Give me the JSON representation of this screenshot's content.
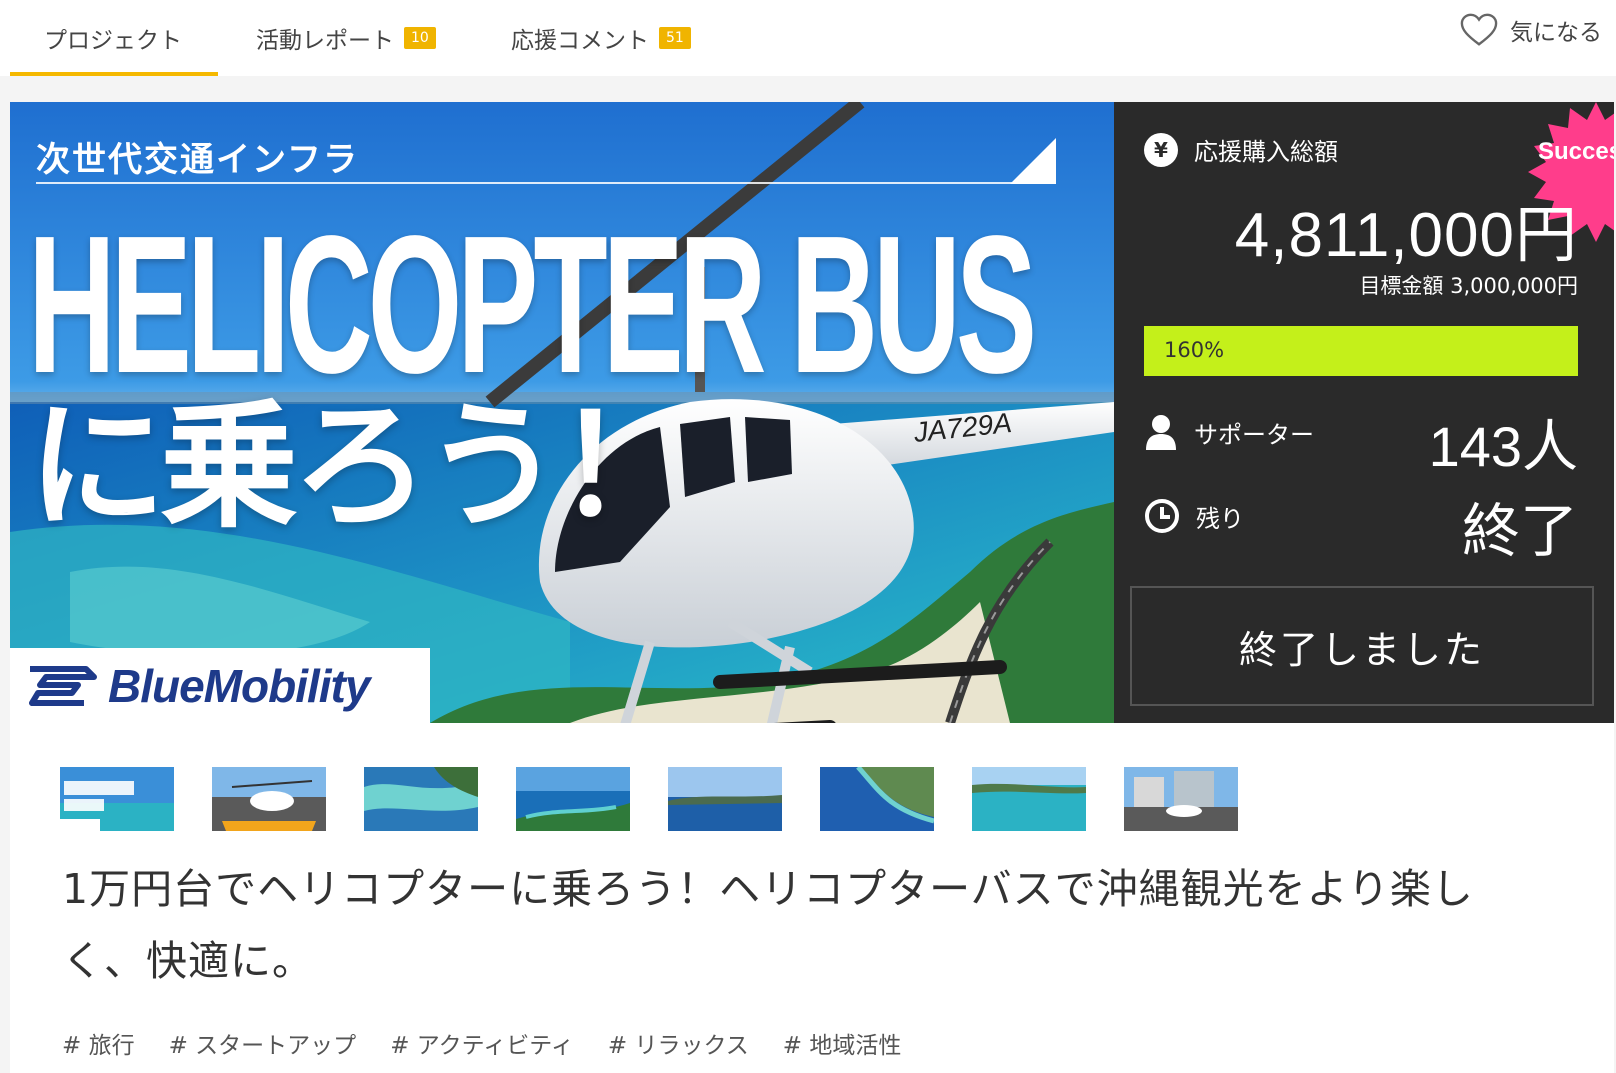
{
  "tabs": [
    {
      "label": "プロジェクト",
      "badge": ""
    },
    {
      "label": "活動レポート",
      "badge": "10"
    },
    {
      "label": "応援コメント",
      "badge": "51"
    }
  ],
  "favorite": {
    "label": "気になる",
    "icon": "heart-icon"
  },
  "hero": {
    "banner_subtitle": "次世代交通インフラ",
    "banner_title_line1": "HELICOPTER BUS",
    "banner_title_line2": "に乗ろう！",
    "brand": "BlueMobility",
    "registration": "JA729A"
  },
  "panel": {
    "total_label": "応援購入総額",
    "total_amount": "4,811,000円",
    "goal": "目標金額 3,000,000円",
    "progress_percent": 160,
    "progress_text": "160%",
    "supporters_label": "サポーター",
    "supporters_value": "143人",
    "remaining_label": "残り",
    "remaining_value": "終了",
    "ended_button": "終了しました",
    "success_badge": "Success!",
    "colors": {
      "panel_bg": "#2a2a2a",
      "progress": "#c4f01a",
      "badge": "#ff3d8b",
      "accent": "#f5b800"
    }
  },
  "thumbnails": [
    {
      "name": "thumb-banner"
    },
    {
      "name": "thumb-helipad"
    },
    {
      "name": "thumb-reef"
    },
    {
      "name": "thumb-coast"
    },
    {
      "name": "thumb-bay"
    },
    {
      "name": "thumb-cape"
    },
    {
      "name": "thumb-beach"
    },
    {
      "name": "thumb-building"
    }
  ],
  "project": {
    "title": "1万円台でヘリコプターに乗ろう！ヘリコプターバスで沖縄観光をより楽しく、快適に。",
    "tags": [
      "# 旅行",
      "# スタートアップ",
      "# アクティビティ",
      "# リラックス",
      "# 地域活性"
    ]
  }
}
